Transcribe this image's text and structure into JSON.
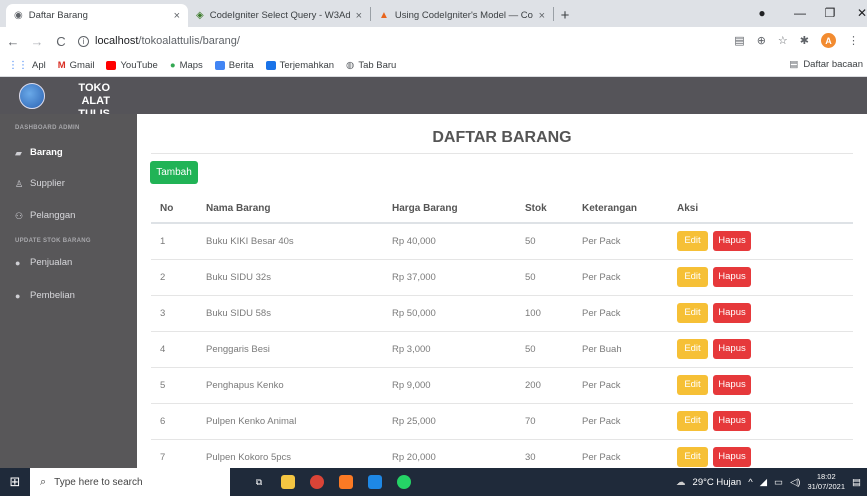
{
  "browser": {
    "tabs": [
      {
        "title": "Daftar Barang",
        "close": "×"
      },
      {
        "title": "CodeIgniter Select Query - W3Ad",
        "close": "×"
      },
      {
        "title": "Using CodeIgniter's Model — Co",
        "close": "×"
      }
    ],
    "new_tab": "+",
    "url_host": "localhost",
    "url_path": "/tokoalattulis/barang/",
    "bookmarks": [
      "Apl",
      "Gmail",
      "YouTube",
      "Maps",
      "Berita",
      "Terjemahkan",
      "Tab Baru"
    ],
    "reading_list": "Daftar bacaan",
    "profile_initial": "A"
  },
  "app": {
    "brand_line1": "TOKO ALAT",
    "brand_line2": "TULIS",
    "sidebar": {
      "section1": "DASHBOARD ADMIN",
      "section2": "UPDATE STOK BARANG",
      "items": [
        "Barang",
        "Supplier",
        "Pelanggan",
        "Penjualan",
        "Pembelian"
      ]
    },
    "page_title": "DAFTAR BARANG",
    "add_button": "Tambah",
    "table": {
      "headers": [
        "No",
        "Nama Barang",
        "Harga Barang",
        "Stok",
        "Keterangan",
        "Aksi"
      ],
      "edit_label": "Edit",
      "delete_label": "Hapus",
      "rows": [
        [
          "1",
          "Buku KIKI Besar 40s",
          "Rp 40,000",
          "50",
          "Per Pack"
        ],
        [
          "2",
          "Buku SIDU 32s",
          "Rp 37,000",
          "50",
          "Per Pack"
        ],
        [
          "3",
          "Buku SIDU 58s",
          "Rp 50,000",
          "100",
          "Per Pack"
        ],
        [
          "4",
          "Penggaris Besi",
          "Rp 3,000",
          "50",
          "Per Buah"
        ],
        [
          "5",
          "Penghapus Kenko",
          "Rp 9,000",
          "200",
          "Per Pack"
        ],
        [
          "6",
          "Pulpen Kenko Animal",
          "Rp 25,000",
          "70",
          "Per Pack"
        ],
        [
          "7",
          "Pulpen Kokoro 5pcs",
          "Rp 20,000",
          "30",
          "Per Pack"
        ]
      ]
    }
  },
  "taskbar": {
    "search_placeholder": "Type here to search",
    "weather": "29°C Hujan",
    "time": "18:02",
    "date": "31/07/2021"
  },
  "colors": {
    "header": "#555459",
    "sidebar": "#585759",
    "add_button": "#21b356",
    "edit_button": "#f6c036",
    "delete_button": "#e6393b"
  }
}
